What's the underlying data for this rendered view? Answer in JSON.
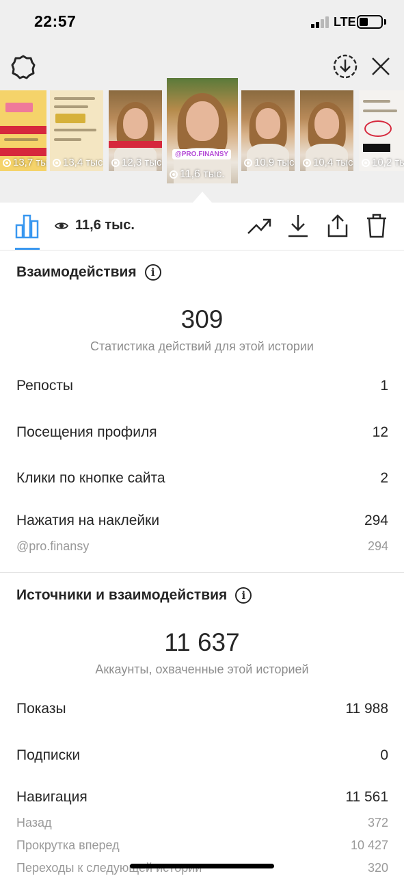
{
  "status_bar": {
    "time": "22:57",
    "network": "LTE"
  },
  "icons": {
    "gear": "gear-icon",
    "download_circle": "download-circle-icon",
    "close": "close-icon",
    "insights": "bar-chart-icon",
    "trend": "trend-icon",
    "download": "download-icon",
    "share": "share-icon",
    "delete": "trash-icon"
  },
  "stories": [
    {
      "views": "13,7 тыс.",
      "kind": "text"
    },
    {
      "views": "13,4 тыс.",
      "kind": "text"
    },
    {
      "views": "12,3 тыс.",
      "kind": "face"
    },
    {
      "views": "11,6 тыс.",
      "kind": "face",
      "selected": true,
      "sticker_text": "@PRO.FINANSY"
    },
    {
      "views": "10,9 тыс.",
      "kind": "face"
    },
    {
      "views": "10,4 тыс.",
      "kind": "face"
    },
    {
      "views": "10,2 тыс.",
      "kind": "text"
    }
  ],
  "toolbar": {
    "views": "11,6 тыс."
  },
  "interactions": {
    "title": "Взаимодействия",
    "total": "309",
    "subtitle": "Статистика действий для этой истории",
    "rows": [
      {
        "label": "Репосты",
        "value": "1"
      },
      {
        "label": "Посещения профиля",
        "value": "12"
      },
      {
        "label": "Клики по кнопке сайта",
        "value": "2"
      },
      {
        "label": "Нажатия на наклейки",
        "value": "294"
      }
    ],
    "sticker_row": {
      "label": "@pro.finansy",
      "value": "294"
    }
  },
  "discovery": {
    "title": "Источники и взаимодействия",
    "total": "11 637",
    "subtitle": "Аккаунты, охваченные этой историей",
    "rows": [
      {
        "label": "Показы",
        "value": "11 988"
      },
      {
        "label": "Подписки",
        "value": "0"
      },
      {
        "label": "Навигация",
        "value": "11 561"
      }
    ],
    "nav_rows": [
      {
        "label": "Назад",
        "value": "372"
      },
      {
        "label": "Прокрутка вперед",
        "value": "10 427"
      },
      {
        "label": "Переходы к следующей истории",
        "value": "320"
      }
    ]
  },
  "colors": {
    "accent": "#3897f0",
    "text": "#262626",
    "muted": "#8e8e8e"
  }
}
